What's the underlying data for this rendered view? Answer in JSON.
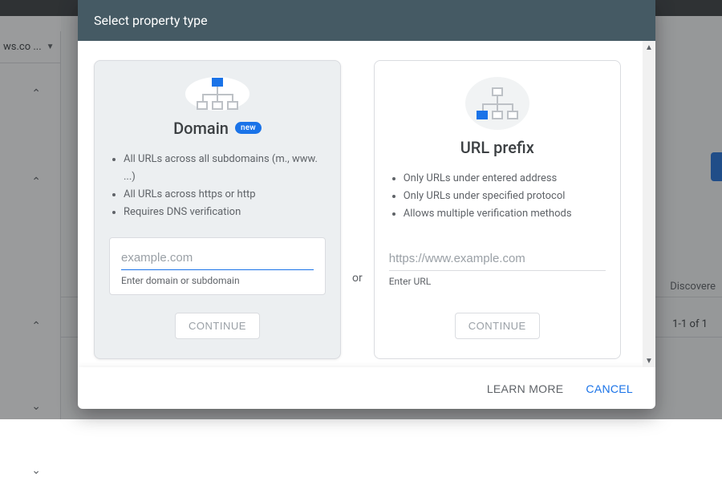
{
  "background": {
    "property_selector": "ws.co ...",
    "column_header": "Discovere",
    "pager": "1-1 of 1"
  },
  "dialog": {
    "title": "Select property type",
    "separator": "or",
    "footer": {
      "learn_more": "LEARN MORE",
      "cancel": "CANCEL"
    },
    "domain": {
      "heading": "Domain",
      "badge": "new",
      "bullets": [
        "All URLs across all subdomains (m., www. ...)",
        "All URLs across https or http",
        "Requires DNS verification"
      ],
      "placeholder": "example.com",
      "helper": "Enter domain or subdomain",
      "continue": "CONTINUE"
    },
    "urlprefix": {
      "heading": "URL prefix",
      "bullets": [
        "Only URLs under entered address",
        "Only URLs under specified protocol",
        "Allows multiple verification methods"
      ],
      "placeholder": "https://www.example.com",
      "helper": "Enter URL",
      "continue": "CONTINUE"
    }
  }
}
